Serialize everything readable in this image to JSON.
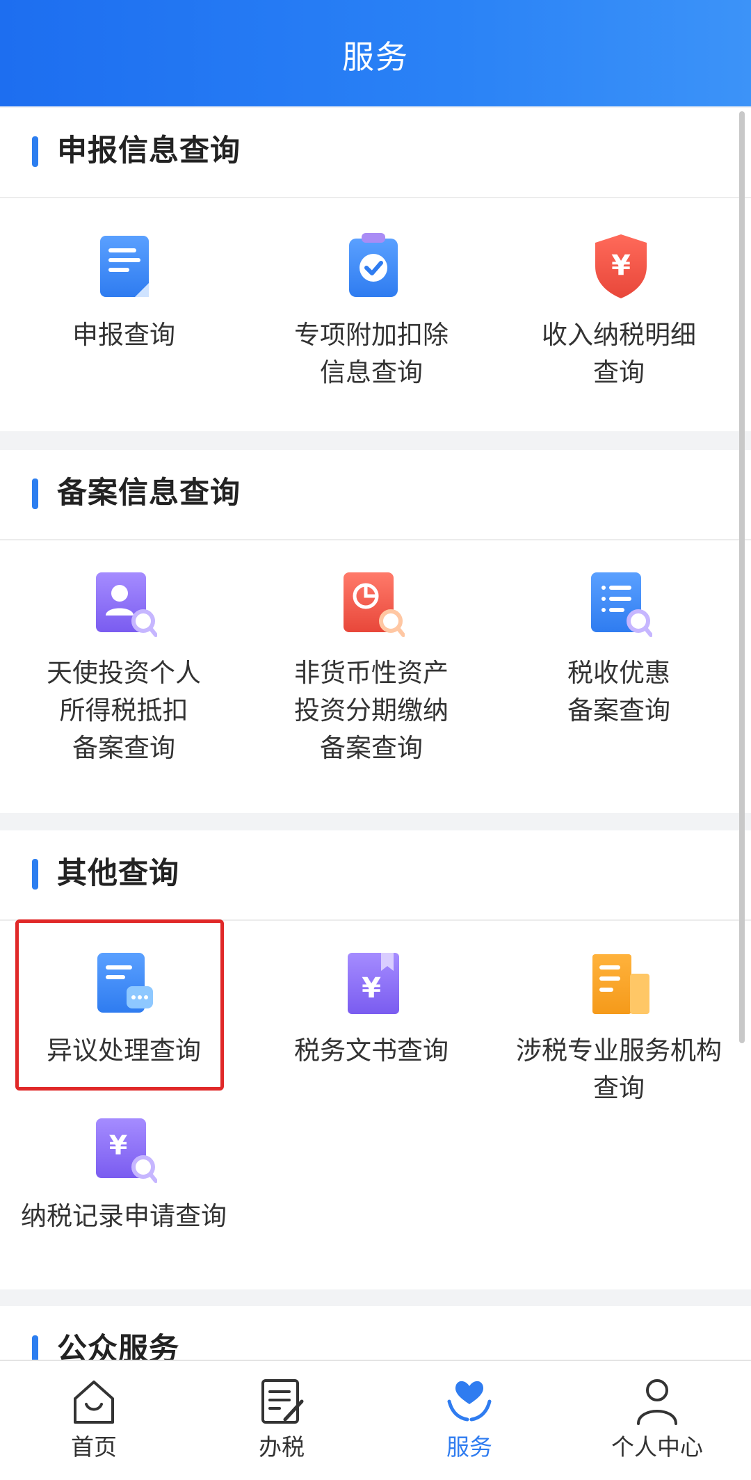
{
  "header": {
    "title": "服务"
  },
  "sections": [
    {
      "title": "申报信息查询",
      "items": [
        {
          "label": "申报查询",
          "icon": "document-icon"
        },
        {
          "label": "专项附加扣除\n信息查询",
          "icon": "clipboard-check-icon"
        },
        {
          "label": "收入纳税明细\n查询",
          "icon": "yuan-shield-icon"
        }
      ]
    },
    {
      "title": "备案信息查询",
      "items": [
        {
          "label": "天使投资个人\n所得税抵扣\n备案查询",
          "icon": "person-search-icon"
        },
        {
          "label": "非货币性资产\n投资分期缴纳\n备案查询",
          "icon": "chart-search-icon"
        },
        {
          "label": "税收优惠\n备案查询",
          "icon": "list-search-icon"
        }
      ]
    },
    {
      "title": "其他查询",
      "items": [
        {
          "label": "异议处理查询",
          "icon": "message-document-icon"
        },
        {
          "label": "税务文书查询",
          "icon": "yuan-book-icon"
        },
        {
          "label": "涉税专业服务机构\n查询",
          "icon": "building-icon"
        },
        {
          "label": "纳税记录申请查询",
          "icon": "yuan-search-icon"
        }
      ]
    },
    {
      "title": "公众服务"
    }
  ],
  "tabs": [
    {
      "label": "首页",
      "icon": "home-icon"
    },
    {
      "label": "办税",
      "icon": "edit-document-icon"
    },
    {
      "label": "服务",
      "icon": "heart-hands-icon",
      "active": true
    },
    {
      "label": "个人中心",
      "icon": "user-icon"
    }
  ],
  "colors": {
    "accent": "#2f7cf0",
    "highlight": "#e02828"
  }
}
